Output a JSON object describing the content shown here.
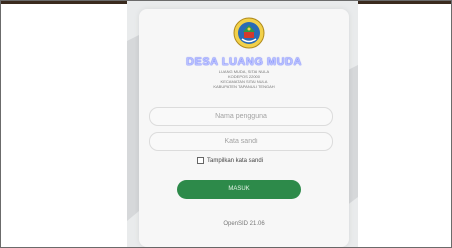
{
  "login": {
    "village_name": "DESA LUANG MUDA",
    "address_lines": [
      "LUANG MUDA, SITAI NULA",
      "KODEPOS 22000",
      "KECAMATAN SITAI NULA",
      "KABUPATEN TAPANULI TENGAH"
    ],
    "username_placeholder": "Nama pengguna",
    "password_placeholder": "Kata sandi",
    "show_password_label": "Tampilkan kata sandi",
    "submit_label": "MASUK",
    "version": "OpenSID 21.06"
  },
  "colors": {
    "accent": "#2d8a4a",
    "title": "#b9c0ff",
    "card": "#f7f7f7",
    "background": "#e9ebec"
  },
  "icons": {
    "logo": "village-emblem-icon",
    "checkbox": "checkbox-icon"
  }
}
